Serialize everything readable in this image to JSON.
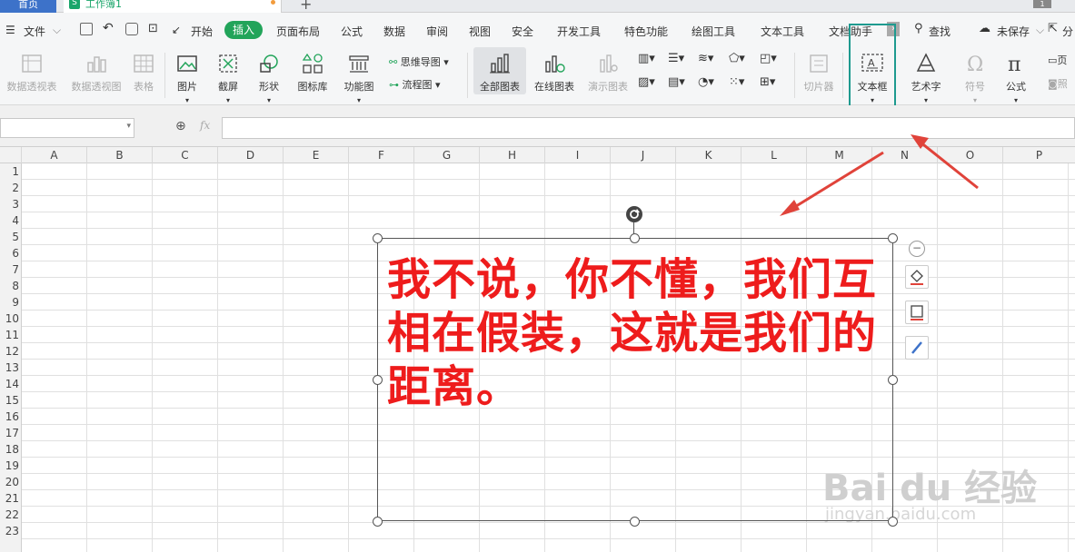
{
  "tabs": {
    "home": "首页",
    "workbook": "工作簿1",
    "add": "+",
    "count": "1"
  },
  "menu": {
    "file": "文件",
    "items": [
      "开始",
      "插入",
      "页面布局",
      "公式",
      "数据",
      "审阅",
      "视图",
      "安全",
      "开发工具",
      "特色功能",
      "绘图工具",
      "文本工具",
      "文档助手"
    ],
    "search": "查找",
    "unsaved": "未保存",
    "share": "分"
  },
  "ribbon": {
    "pivot_table": "数据透视表",
    "pivot_chart": "数据透视图",
    "table": "表格",
    "picture": "图片",
    "screenshot": "截屏",
    "shape": "形状",
    "icon_lib": "图标库",
    "func_chart": "功能图",
    "mindmap": "思维导图",
    "flowchart": "流程图",
    "all_charts": "全部图表",
    "online_chart": "在线图表",
    "demo_chart": "演示图表",
    "slicer": "切片器",
    "textbox": "文本框",
    "wordart": "艺术字",
    "symbol": "符号",
    "formula": "公式",
    "header_partial": "页",
    "photo_partial": "照"
  },
  "formula_bar": {
    "fx": "fx",
    "value": ""
  },
  "columns": [
    "A",
    "B",
    "C",
    "D",
    "E",
    "F",
    "G",
    "H",
    "I",
    "J",
    "K",
    "L",
    "M",
    "N",
    "O",
    "P"
  ],
  "rows": [
    "1",
    "2",
    "3",
    "4",
    "5",
    "6",
    "7",
    "8",
    "9",
    "10",
    "11",
    "12",
    "13",
    "14",
    "15",
    "16",
    "17",
    "18",
    "19",
    "20",
    "21",
    "22",
    "23"
  ],
  "textbox": {
    "text": "我不说，你不懂，我们互相在假装，这就是我们的距离。",
    "color": "#ee1c1c"
  },
  "watermark": {
    "brand": "Bai du 经验",
    "url": "jingyan.baidu.com"
  },
  "colors": {
    "accent": "#22a45a",
    "highlight": "#1e9a8f",
    "arrow": "#e0433a"
  }
}
